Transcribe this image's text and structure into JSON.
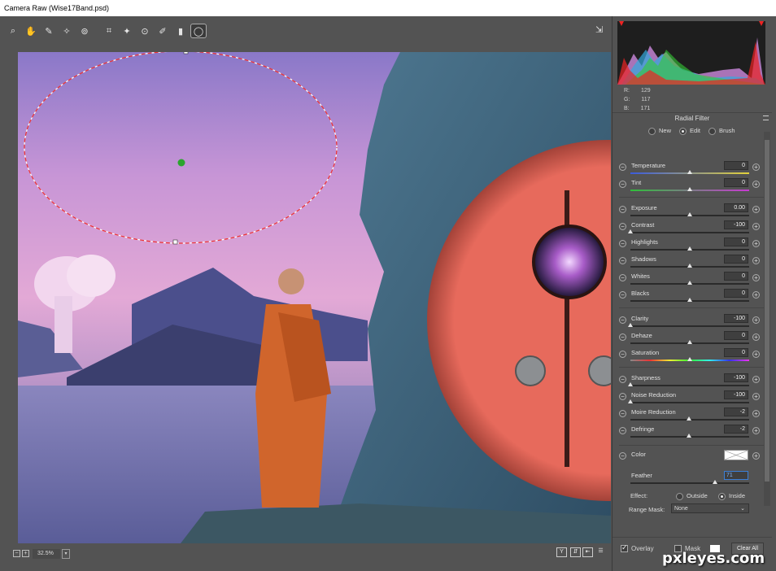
{
  "window": {
    "title": "Camera Raw (Wise17Band.psd)"
  },
  "toolbar": {
    "tools": [
      {
        "name": "zoom-tool",
        "glyph": "⌕"
      },
      {
        "name": "hand-tool",
        "glyph": "✋"
      },
      {
        "name": "white-balance-tool",
        "glyph": "✎"
      },
      {
        "name": "color-sampler-tool",
        "glyph": "✧"
      },
      {
        "name": "targeted-adjustment-tool",
        "glyph": "⊚"
      },
      {
        "name": "crop-tool",
        "glyph": "⌗"
      },
      {
        "name": "spot-removal-tool",
        "glyph": "✦"
      },
      {
        "name": "red-eye-tool",
        "glyph": "⊙"
      },
      {
        "name": "adjustment-brush-tool",
        "glyph": "✐"
      },
      {
        "name": "graduated-filter-tool",
        "glyph": "▮"
      },
      {
        "name": "radial-filter-tool",
        "glyph": "◯"
      }
    ]
  },
  "histogram": {
    "r_label": "R:",
    "r": "129",
    "g_label": "G:",
    "g": "117",
    "b_label": "B:",
    "b": "171"
  },
  "panel": {
    "title": "Radial Filter",
    "modes": [
      {
        "label": "New",
        "on": false
      },
      {
        "label": "Edit",
        "on": true
      },
      {
        "label": "Brush",
        "on": false
      }
    ],
    "sliders": [
      {
        "label": "Temperature",
        "value": "0",
        "pos": 0.5,
        "group": 0
      },
      {
        "label": "Tint",
        "value": "0",
        "pos": 0.5,
        "group": 0
      },
      {
        "label": "Exposure",
        "value": "0.00",
        "pos": 0.5,
        "group": 1
      },
      {
        "label": "Contrast",
        "value": "-100",
        "pos": 0.0,
        "group": 1
      },
      {
        "label": "Highlights",
        "value": "0",
        "pos": 0.5,
        "group": 1
      },
      {
        "label": "Shadows",
        "value": "0",
        "pos": 0.5,
        "group": 1
      },
      {
        "label": "Whites",
        "value": "0",
        "pos": 0.5,
        "group": 1
      },
      {
        "label": "Blacks",
        "value": "0",
        "pos": 0.5,
        "group": 1
      },
      {
        "label": "Clarity",
        "value": "-100",
        "pos": 0.0,
        "group": 2
      },
      {
        "label": "Dehaze",
        "value": "0",
        "pos": 0.5,
        "group": 2
      },
      {
        "label": "Saturation",
        "value": "0",
        "pos": 0.5,
        "group": 2
      },
      {
        "label": "Sharpness",
        "value": "-100",
        "pos": 0.0,
        "group": 3
      },
      {
        "label": "Noise Reduction",
        "value": "-100",
        "pos": 0.0,
        "group": 3
      },
      {
        "label": "Moire Reduction",
        "value": "-2",
        "pos": 0.49,
        "group": 3
      },
      {
        "label": "Defringe",
        "value": "-2",
        "pos": 0.49,
        "group": 3
      }
    ],
    "color_label": "Color",
    "feather_label": "Feather",
    "feather_value": "71",
    "feather_pos": 0.71,
    "effect_label": "Effect:",
    "effect_outside": "Outside",
    "effect_inside": "Inside",
    "range_mask_label": "Range Mask:",
    "range_mask_value": "None",
    "overlay_label": "Overlay",
    "mask_label": "Mask",
    "clear_all": "Clear All"
  },
  "status": {
    "zoom": "32.5%",
    "minus": "−",
    "plus": "+"
  },
  "watermark": "pxleyes.com"
}
